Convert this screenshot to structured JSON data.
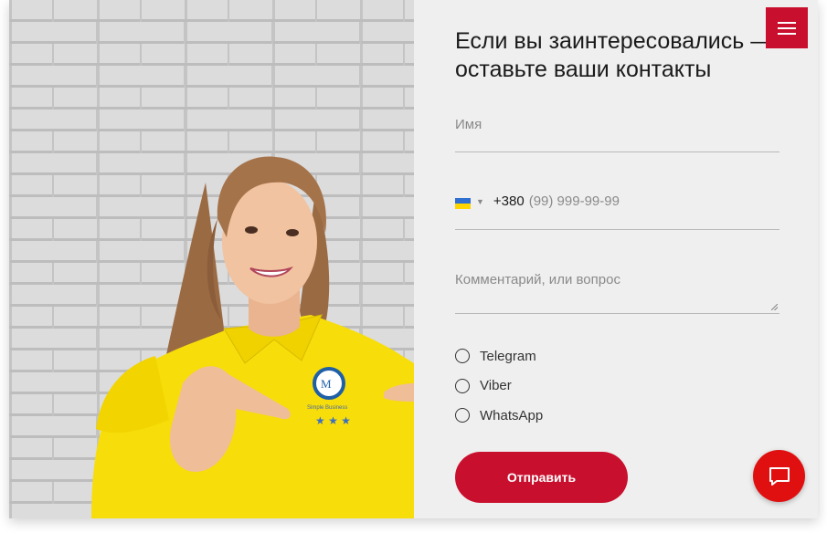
{
  "form": {
    "heading": "Если вы заинтересовались — оставьте ваши контакты",
    "name_placeholder": "Имя",
    "phone_country_code": "+380",
    "phone_placeholder": "(99) 999-99-99",
    "comment_placeholder": "Комментарий, или вопрос",
    "messengers": [
      {
        "label": "Telegram"
      },
      {
        "label": "Viber"
      },
      {
        "label": "WhatsApp"
      }
    ],
    "submit_label": "Отправить"
  },
  "icons": {
    "menu": "hamburger-menu-icon",
    "chat": "chat-bubble-icon",
    "flag": "ukraine-flag-icon"
  },
  "colors": {
    "accent": "#c8102e",
    "chat": "#e01010",
    "panel": "#efefef"
  },
  "photo": {
    "shirt_logo_text": "Simple Business"
  }
}
